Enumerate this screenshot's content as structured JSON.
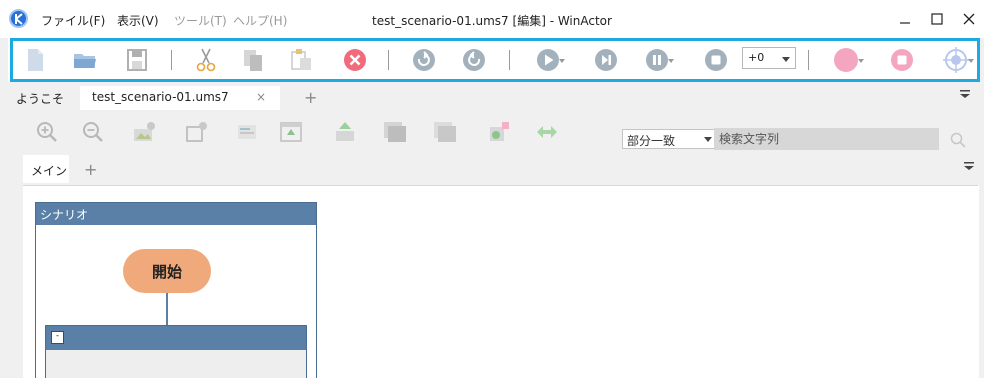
{
  "window": {
    "title": "test_scenario-01.ums7 [編集] - WinActor",
    "menus": [
      {
        "label": "ファイル(F)",
        "enabled": true
      },
      {
        "label": "表示(V)",
        "enabled": true
      },
      {
        "label": "ツール(T)",
        "enabled": false
      },
      {
        "label": "ヘルプ(H)",
        "enabled": false
      }
    ],
    "controls": {
      "minimize": "minimize-icon",
      "maximize": "maximize-icon",
      "close": "close-icon"
    }
  },
  "toolbar": {
    "highlight_color": "#1fa9e1",
    "buttons": [
      "new-file-icon",
      "open-folder-icon",
      "save-icon",
      "cut-icon",
      "copy-icon",
      "paste-icon",
      "delete-icon",
      "undo-icon",
      "redo-icon",
      "play-icon",
      "step-icon",
      "pause-icon",
      "stop-icon",
      "record-icon",
      "record-stop-icon",
      "target-icon"
    ],
    "speed_value": "+0"
  },
  "doc_tabs": {
    "welcome": "ようこそ",
    "scenario": "test_scenario-01.ums7",
    "close_symbol": "×",
    "add_symbol": "+"
  },
  "sub_toolbar": {
    "icons": [
      "zoom-in-icon",
      "zoom-out-icon",
      "image-icon",
      "group-add-icon",
      "list-icon",
      "export-icon",
      "import-icon",
      "window-icon",
      "window-alt-icon",
      "add-node-icon",
      "swap-icon"
    ],
    "match_mode": "部分一致",
    "search_placeholder": "検索文字列"
  },
  "sub_tabs": {
    "main": "メイン",
    "add_symbol": "+"
  },
  "canvas": {
    "scenario_title": "シナリオ",
    "start_label": "開始",
    "group_collapse": "-",
    "colors": {
      "header": "#5a80a8",
      "start_node": "#f0a97a",
      "group_body": "#eeeeee"
    }
  }
}
